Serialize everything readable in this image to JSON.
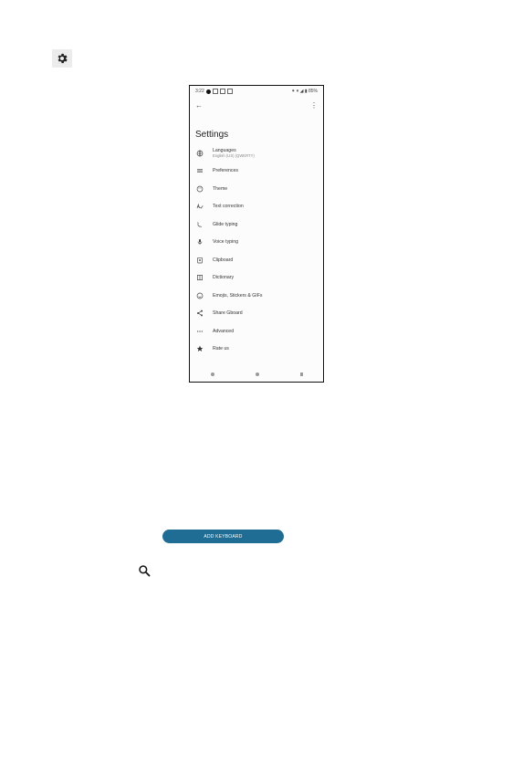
{
  "top_icon": "gear-icon",
  "phone": {
    "status_time": "3:22",
    "status_right": "⁕ ▾ ◢ ▮ 85%",
    "back_icon": "back-arrow-icon",
    "more_icon": "more-vert-icon",
    "title": "Settings",
    "items": [
      {
        "icon": "globe-icon",
        "label": "Languages",
        "sub": "English (US) (QWERTY)"
      },
      {
        "icon": "sliders-icon",
        "label": "Preferences",
        "sub": ""
      },
      {
        "icon": "palette-icon",
        "label": "Theme",
        "sub": ""
      },
      {
        "icon": "text-correction-icon",
        "label": "Text correction",
        "sub": ""
      },
      {
        "icon": "glide-icon",
        "label": "Glide typing",
        "sub": ""
      },
      {
        "icon": "mic-icon",
        "label": "Voice typing",
        "sub": ""
      },
      {
        "icon": "clipboard-icon",
        "label": "Clipboard",
        "sub": ""
      },
      {
        "icon": "book-icon",
        "label": "Dictionary",
        "sub": ""
      },
      {
        "icon": "emoji-icon",
        "label": "Emojis, Stickers & GIFs",
        "sub": ""
      },
      {
        "icon": "share-icon",
        "label": "Share Gboard",
        "sub": ""
      },
      {
        "icon": "dots-icon",
        "label": "Advanced",
        "sub": ""
      },
      {
        "icon": "star-icon",
        "label": "Rate us",
        "sub": ""
      }
    ]
  },
  "add_keyboard_button": "ADD KEYBOARD",
  "bottom_icon": "search-icon"
}
